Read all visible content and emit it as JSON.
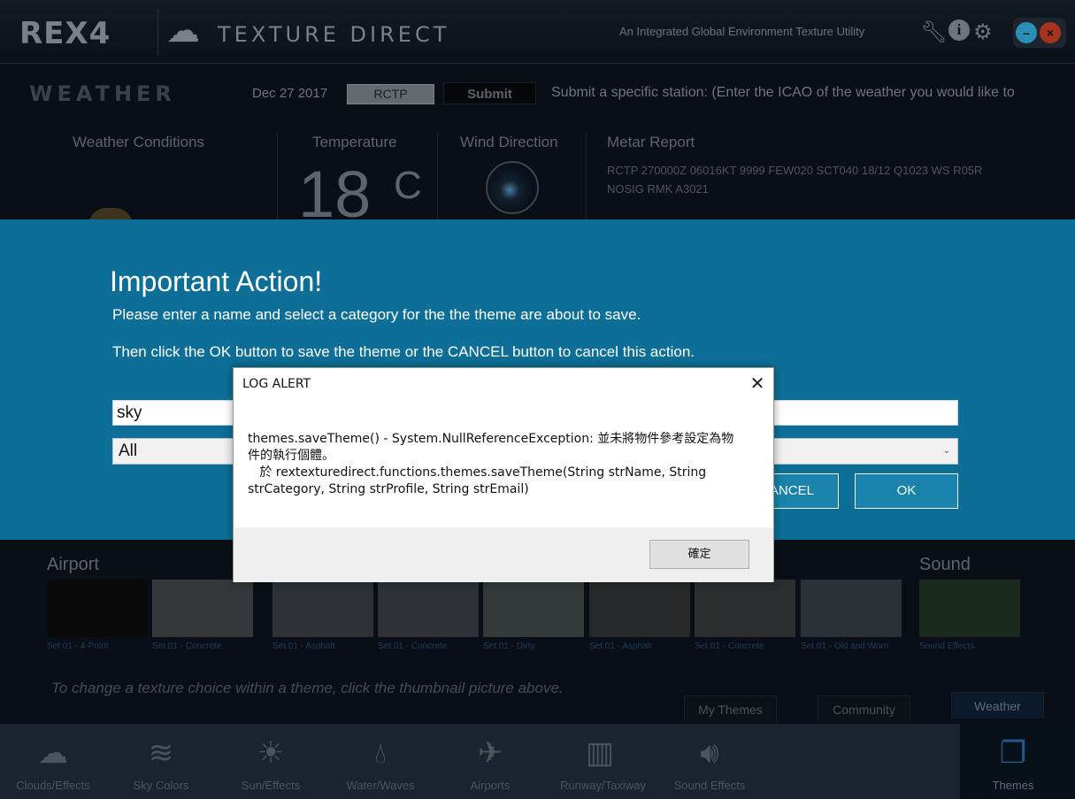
{
  "header": {
    "logo": "REX4",
    "brand": "TEXTURE DIRECT",
    "tagline": "An Integrated Global Environment Texture Utility"
  },
  "weather": {
    "title": "WEATHER",
    "date": "Dec 27 2017",
    "icao": "RCTP",
    "submit_label": "Submit",
    "submit_hint": "Submit a specific station: (Enter the ICAO of the weather you would like to",
    "conditions_label": "Weather Conditions",
    "temperature_label": "Temperature",
    "temperature": "18",
    "temp_unit": "C",
    "wind_label": "Wind Direction",
    "metar_label": "Metar Report",
    "metar": "RCTP 270000Z 06016KT 9999 FEW020 SCT040 18/12 Q1023 WS R05R NOSIG RMK A3021"
  },
  "save_dialog": {
    "title": "Important Action!",
    "line1": "Please enter a name and select a category for the the theme are about to save.",
    "line2": "Then click the OK button to save the theme or the CANCEL button to cancel this action.",
    "name_value": "sky",
    "category_value": "All",
    "cancel_label": "CANCEL",
    "ok_label": "OK"
  },
  "alert": {
    "title": "LOG ALERT",
    "message": "themes.saveTheme() - System.NullReferenceException: 並未將物件參考設定為物件的執行個體。\n   於 rextexturedirect.functions.themes.saveTheme(String strName, String strCategory, String strProfile, String strEmail)",
    "ok_label": "確定"
  },
  "sections": {
    "airport": "Airport",
    "sound": "Sound"
  },
  "thumbnails": [
    "Set 01 - 4-Point",
    "Set 01 - Concrete",
    "Set 01 - Asphalt",
    "Set 01 - Concrete",
    "Set 01 - Dirty",
    "Set 01 - Asphalt",
    "Set 01 - Concrete",
    "Set 01 - Old and Worn",
    "Sound Effects"
  ],
  "hint": "To change a texture choice within a theme, click the thumbnail picture above.",
  "tabs": [
    "My Themes",
    "Community",
    "Weather"
  ],
  "toolbar": [
    {
      "label": "Clouds/Effects",
      "icon": "cloud-icon"
    },
    {
      "label": "Sky Colors",
      "icon": "wind-icon"
    },
    {
      "label": "Sun/Effects",
      "icon": "sun-icon"
    },
    {
      "label": "Water/Waves",
      "icon": "water-drop-icon"
    },
    {
      "label": "Airports",
      "icon": "airplane-icon"
    },
    {
      "label": "Runway/Taxiway",
      "icon": "runway-icon"
    },
    {
      "label": "Sound Effects",
      "icon": "speaker-icon"
    },
    {
      "label": "Themes",
      "icon": "themes-icon"
    }
  ],
  "colors": {
    "overlay": "#0d6f97",
    "active_tab": "#1e5a8a"
  }
}
